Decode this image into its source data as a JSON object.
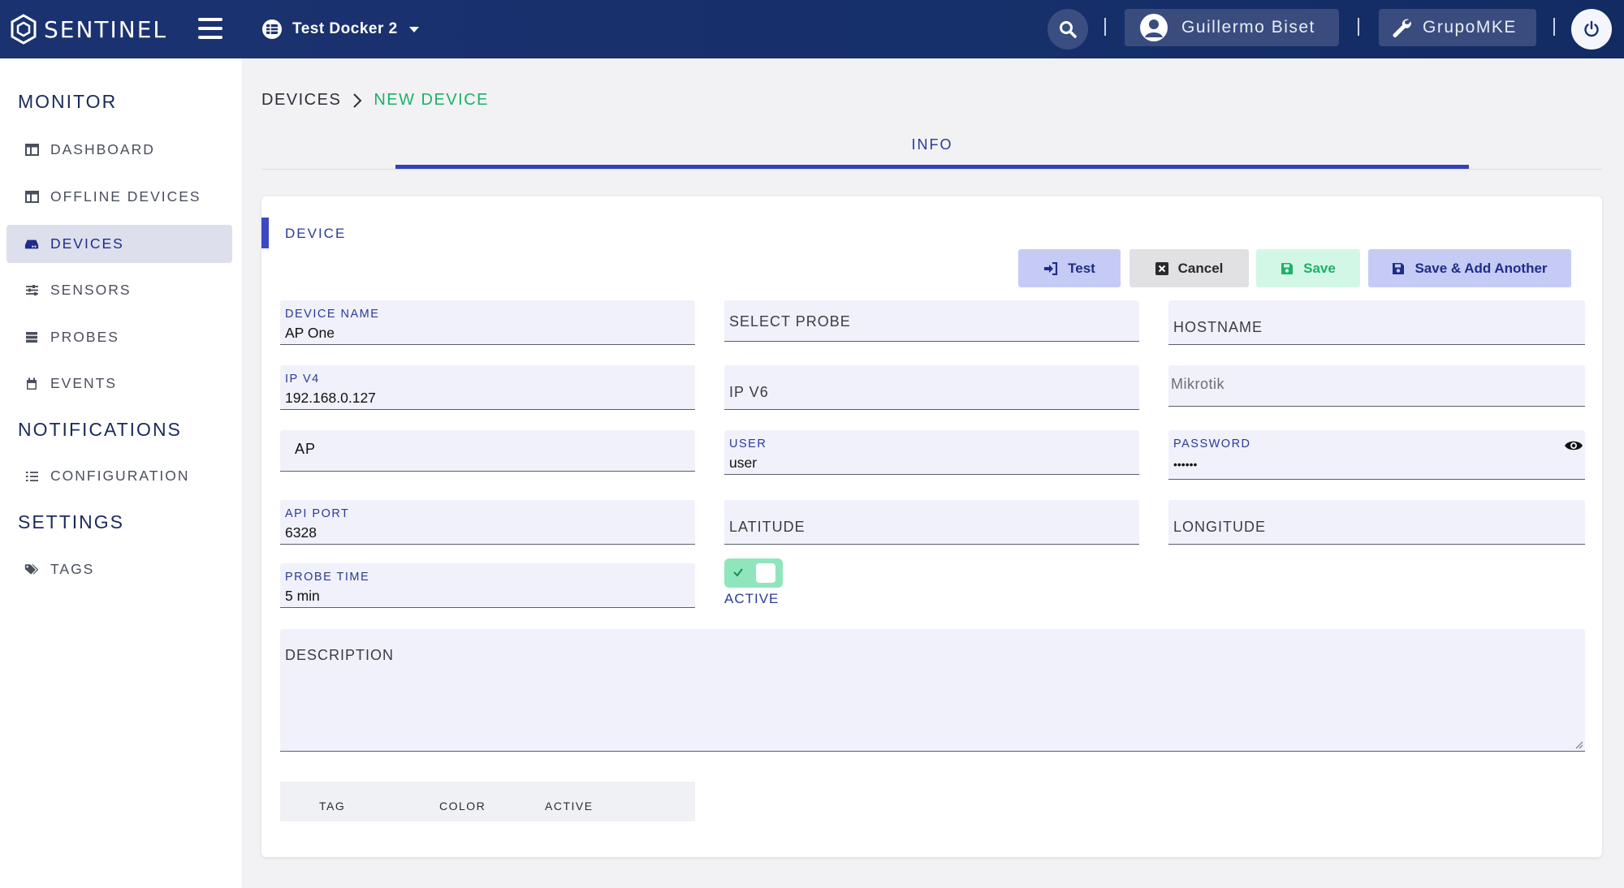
{
  "topbar": {
    "brand": "SENTINEL",
    "project": "Test Docker 2",
    "user": "Guillermo Biset",
    "org": "GrupoMKE"
  },
  "sidebar": {
    "sections": [
      {
        "heading": "MONITOR"
      },
      {
        "heading": "NOTIFICATIONS"
      },
      {
        "heading": "SETTINGS"
      }
    ],
    "items": [
      {
        "label": "DASHBOARD",
        "icon": "table-columns-icon"
      },
      {
        "label": "OFFLINE DEVICES",
        "icon": "table-columns-icon"
      },
      {
        "label": "DEVICES",
        "icon": "hdd-icon",
        "active": true
      },
      {
        "label": "SENSORS",
        "icon": "sliders-icon"
      },
      {
        "label": "PROBES",
        "icon": "server-icon"
      },
      {
        "label": "EVENTS",
        "icon": "calendar-icon"
      },
      {
        "label": "CONFIGURATION",
        "icon": "list-icon"
      },
      {
        "label": "TAGS",
        "icon": "tags-icon"
      }
    ]
  },
  "breadcrumb": {
    "parent": "DEVICES",
    "current": "NEW DEVICE"
  },
  "tabs": [
    {
      "label": "INFO",
      "active": true
    }
  ],
  "section": {
    "title": "DEVICE"
  },
  "actions": {
    "test": "Test",
    "cancel": "Cancel",
    "save": "Save",
    "save_add": "Save & Add Another"
  },
  "form": {
    "device_name": {
      "label": "DEVICE NAME",
      "value": "AP One"
    },
    "select_probe": {
      "placeholder": "SELECT PROBE"
    },
    "hostname": {
      "placeholder": "HOSTNAME"
    },
    "ipv4": {
      "label": "IP V4",
      "value": "192.168.0.127"
    },
    "ipv6": {
      "placeholder": "IP V6"
    },
    "vendor": {
      "value": "Mikrotik"
    },
    "type": {
      "value": "AP"
    },
    "user": {
      "label": "USER",
      "value": "user"
    },
    "password": {
      "label": "PASSWORD",
      "value": "••••••"
    },
    "api_port": {
      "label": "API PORT",
      "value": "6328"
    },
    "latitude": {
      "placeholder": "LATITUDE"
    },
    "longitude": {
      "placeholder": "LONGITUDE"
    },
    "probe_time": {
      "label": "PROBE TIME",
      "value": "5 min"
    },
    "active": {
      "label": "ACTIVE",
      "checked": true
    },
    "description": {
      "placeholder": "DESCRIPTION"
    }
  },
  "tags_table": {
    "columns": [
      "TAG",
      "COLOR",
      "ACTIVE"
    ]
  },
  "colors": {
    "accent": "#3341b8",
    "success": "#1db16a",
    "topbar": "#16306b"
  }
}
